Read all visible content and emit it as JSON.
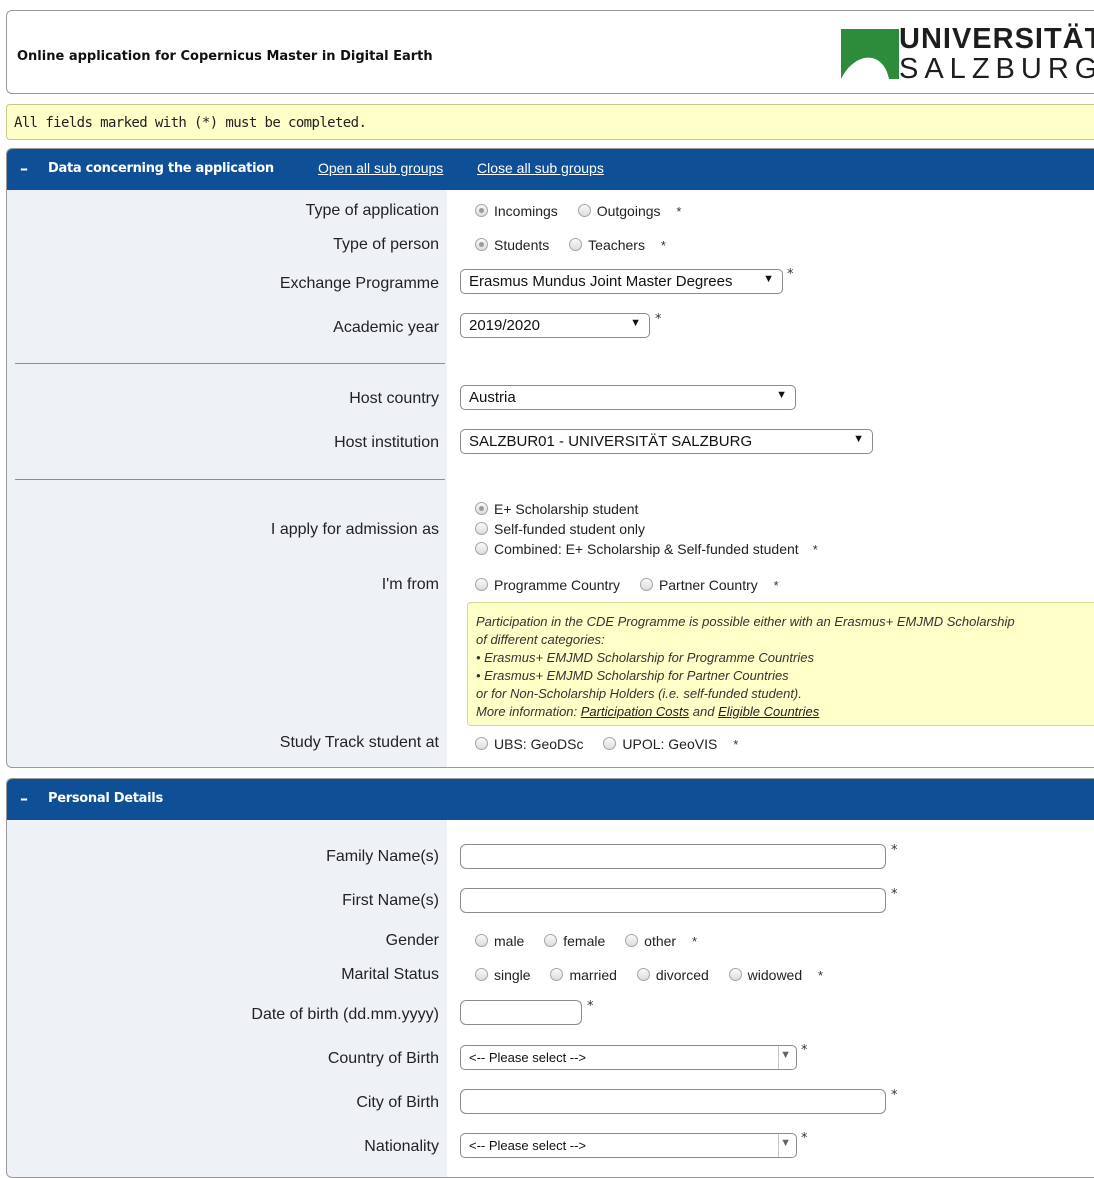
{
  "header": {
    "title": "Online application for Copernicus Master in Digital Earth"
  },
  "logo": {
    "line1": "UNIVERSITÄT",
    "line2": "SALZBURG",
    "brand_color": "#2c8c3c"
  },
  "notice": "All fields marked with (*) must be completed.",
  "required_mark": "*",
  "section1": {
    "toggle": "–",
    "title": "Data concerning the application",
    "open_all": "Open all sub groups",
    "close_all": "Close all sub groups",
    "type_of_application": {
      "label": "Type of application",
      "options": [
        "Incomings",
        "Outgoings"
      ],
      "selected": "Incomings"
    },
    "type_of_person": {
      "label": "Type of person",
      "options": [
        "Students",
        "Teachers"
      ],
      "selected": "Students"
    },
    "exchange_programme": {
      "label": "Exchange Programme",
      "value": "Erasmus Mundus Joint Master Degrees"
    },
    "academic_year": {
      "label": "Academic year",
      "value": "2019/2020"
    },
    "host_country": {
      "label": "Host country",
      "value": "Austria"
    },
    "host_institution": {
      "label": "Host institution",
      "value": "SALZBUR01 - UNIVERSITÄT SALZBURG"
    },
    "admission": {
      "label": "I apply for admission as",
      "options": [
        "E+ Scholarship student",
        "Self-funded student only",
        "Combined: E+ Scholarship & Self-funded student"
      ],
      "selected": "E+ Scholarship student"
    },
    "from": {
      "label": "I'm from",
      "options": [
        "Programme Country",
        "Partner Country"
      ]
    },
    "info": {
      "line1": "Participation in the CDE Programme is possible either with an Erasmus+ EMJMD Scholarship",
      "line2": "of different categories:",
      "line3": "• Erasmus+ EMJMD Scholarship for Programme Countries",
      "line4": "• Erasmus+ EMJMD Scholarship for Partner Countries",
      "line5": "or for Non-Scholarship Holders (i.e. self-funded student).",
      "more_prefix": "More information: ",
      "link1": "Participation Costs",
      "and": " and ",
      "link2": "Eligible Countries"
    },
    "study_track": {
      "label": "Study Track student at",
      "options": [
        "UBS: GeoDSc",
        "UPOL: GeoVIS"
      ]
    }
  },
  "section2": {
    "toggle": "–",
    "title": "Personal Details",
    "family_name": {
      "label": "Family Name(s)",
      "value": ""
    },
    "first_name": {
      "label": "First Name(s)",
      "value": ""
    },
    "gender": {
      "label": "Gender",
      "options": [
        "male",
        "female",
        "other"
      ]
    },
    "marital_status": {
      "label": "Marital Status",
      "options": [
        "single",
        "married",
        "divorced",
        "widowed"
      ]
    },
    "date_of_birth": {
      "label": "Date of birth (dd.mm.yyyy)",
      "value": ""
    },
    "country_of_birth": {
      "label": "Country of Birth",
      "value": "<-- Please select -->"
    },
    "city_of_birth": {
      "label": "City of Birth",
      "value": ""
    },
    "nationality": {
      "label": "Nationality",
      "value": "<-- Please select -->"
    }
  }
}
